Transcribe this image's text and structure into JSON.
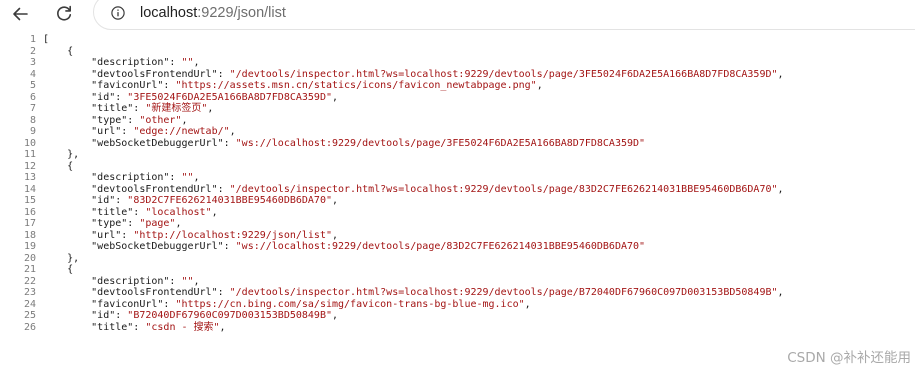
{
  "toolbar": {
    "back_icon": "back-arrow-icon",
    "reload_icon": "reload-icon",
    "info_icon": "info-icon",
    "url_host": "localhost",
    "url_path": ":9229/json/list"
  },
  "code_lines": [
    {
      "n": "1",
      "k": "[",
      "v": ""
    },
    {
      "n": "2",
      "k": "    {",
      "v": ""
    },
    {
      "n": "3",
      "k": "        \"description\": ",
      "v": "\"\"",
      "t": ","
    },
    {
      "n": "4",
      "k": "        \"devtoolsFrontendUrl\": ",
      "v": "\"/devtools/inspector.html?ws=localhost:9229/devtools/page/3FE5024F6DA2E5A166BA8D7FD8CA359D\"",
      "t": ","
    },
    {
      "n": "5",
      "k": "        \"faviconUrl\": ",
      "v": "\"https://assets.msn.cn/statics/icons/favicon_newtabpage.png\"",
      "t": ","
    },
    {
      "n": "6",
      "k": "        \"id\": ",
      "v": "\"3FE5024F6DA2E5A166BA8D7FD8CA359D\"",
      "t": ","
    },
    {
      "n": "7",
      "k": "        \"title\": ",
      "v": "\"新建标签页\"",
      "t": ","
    },
    {
      "n": "8",
      "k": "        \"type\": ",
      "v": "\"other\"",
      "t": ","
    },
    {
      "n": "9",
      "k": "        \"url\": ",
      "v": "\"edge://newtab/\"",
      "t": ","
    },
    {
      "n": "10",
      "k": "        \"webSocketDebuggerUrl\": ",
      "v": "\"ws://localhost:9229/devtools/page/3FE5024F6DA2E5A166BA8D7FD8CA359D\"",
      "t": ""
    },
    {
      "n": "11",
      "k": "    },",
      "v": ""
    },
    {
      "n": "12",
      "k": "    {",
      "v": ""
    },
    {
      "n": "13",
      "k": "        \"description\": ",
      "v": "\"\"",
      "t": ","
    },
    {
      "n": "14",
      "k": "        \"devtoolsFrontendUrl\": ",
      "v": "\"/devtools/inspector.html?ws=localhost:9229/devtools/page/83D2C7FE626214031BBE95460DB6DA70\"",
      "t": ","
    },
    {
      "n": "15",
      "k": "        \"id\": ",
      "v": "\"83D2C7FE626214031BBE95460DB6DA70\"",
      "t": ","
    },
    {
      "n": "16",
      "k": "        \"title\": ",
      "v": "\"localhost\"",
      "t": ","
    },
    {
      "n": "17",
      "k": "        \"type\": ",
      "v": "\"page\"",
      "t": ","
    },
    {
      "n": "18",
      "k": "        \"url\": ",
      "v": "\"http://localhost:9229/json/list\"",
      "t": ","
    },
    {
      "n": "19",
      "k": "        \"webSocketDebuggerUrl\": ",
      "v": "\"ws://localhost:9229/devtools/page/83D2C7FE626214031BBE95460DB6DA70\"",
      "t": ""
    },
    {
      "n": "20",
      "k": "    },",
      "v": ""
    },
    {
      "n": "21",
      "k": "    {",
      "v": ""
    },
    {
      "n": "22",
      "k": "        \"description\": ",
      "v": "\"\"",
      "t": ","
    },
    {
      "n": "23",
      "k": "        \"devtoolsFrontendUrl\": ",
      "v": "\"/devtools/inspector.html?ws=localhost:9229/devtools/page/B72040DF67960C097D003153BD50849B\"",
      "t": ","
    },
    {
      "n": "24",
      "k": "        \"faviconUrl\": ",
      "v": "\"https://cn.bing.com/sa/simg/favicon-trans-bg-blue-mg.ico\"",
      "t": ","
    },
    {
      "n": "25",
      "k": "        \"id\": ",
      "v": "\"B72040DF67960C097D003153BD50849B\"",
      "t": ","
    },
    {
      "n": "26",
      "k": "        \"title\": ",
      "v": "\"csdn - 搜索\"",
      "t": ","
    }
  ],
  "watermark": "CSDN @补补还能用"
}
